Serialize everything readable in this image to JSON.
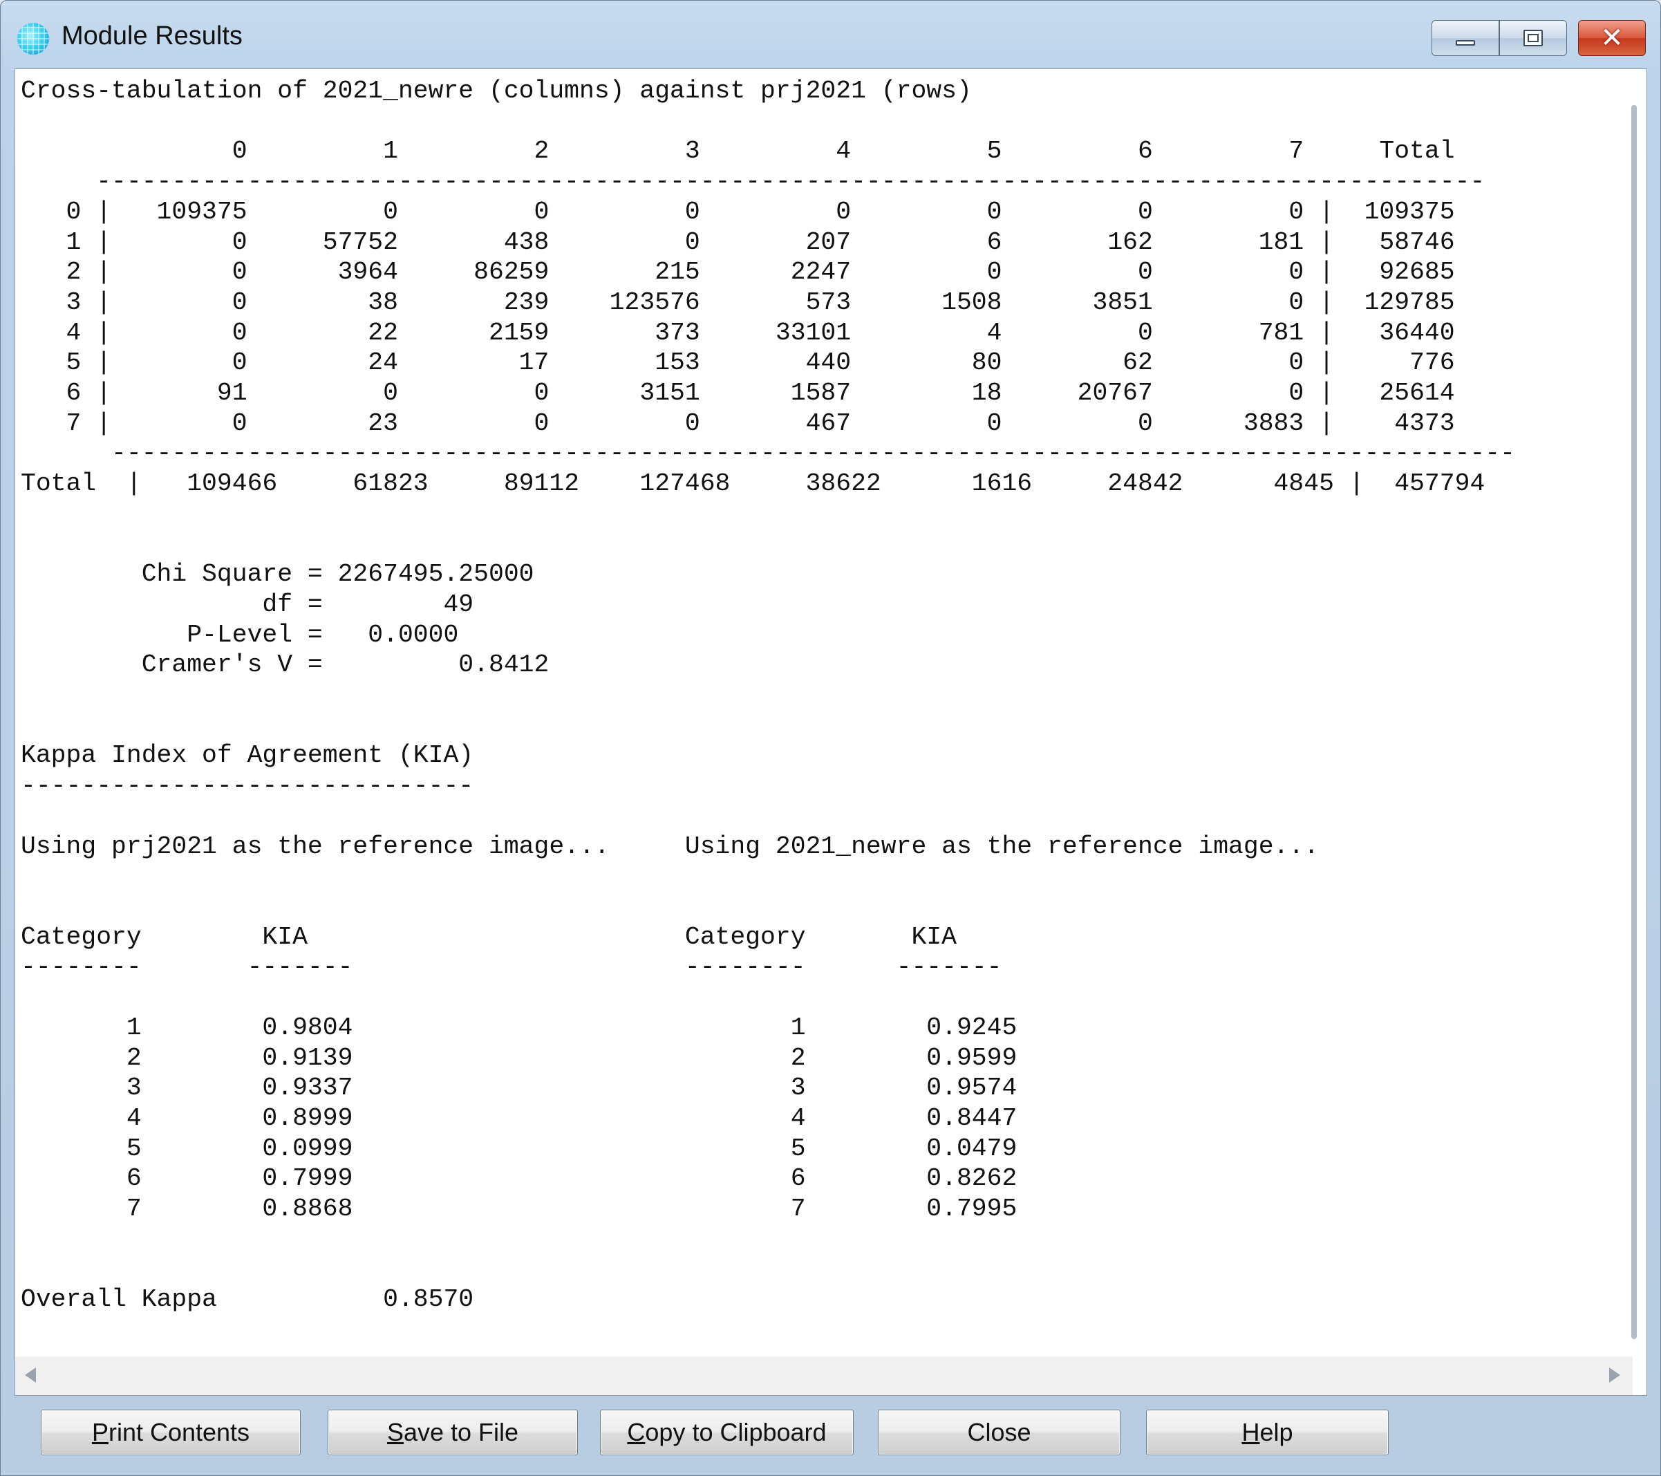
{
  "window": {
    "title": "Module Results",
    "icon": "idrisi-globe-icon",
    "controls": {
      "minimize": "minimize-icon",
      "maximize": "maximize-icon",
      "close": "close-icon"
    }
  },
  "report": {
    "text": "Cross-tabulation of 2021_newre (columns) against prj2021 (rows)\n\n              0         1         2         3         4         5         6         7     Total\n     --------------------------------------------------------------------------------------------\n   0 |   109375         0         0         0         0         0         0         0 |  109375\n   1 |        0     57752       438         0       207         6       162       181 |   58746\n   2 |        0      3964     86259       215      2247         0         0         0 |   92685\n   3 |        0        38       239    123576       573      1508      3851         0 |  129785\n   4 |        0        22      2159       373     33101         4         0       781 |   36440\n   5 |        0        24        17       153       440        80        62         0 |     776\n   6 |       91         0         0      3151      1587        18     20767         0 |   25614\n   7 |        0        23         0         0       467         0         0      3883 |    4373\n      ---------------------------------------------------------------------------------------------\nTotal  |   109466     61823     89112    127468     38622      1616     24842      4845 |  457794\n\n\n        Chi Square = 2267495.25000\n                df =        49\n           P-Level =   0.0000\n        Cramer's V =         0.8412\n\n\nKappa Index of Agreement (KIA)\n------------------------------\n\nUsing prj2021 as the reference image...     Using 2021_newre as the reference image...\n\n\nCategory        KIA                         Category       KIA\n--------       -------                      --------      -------\n\n       1        0.9804                             1        0.9245\n       2        0.9139                             2        0.9599\n       3        0.9337                             3        0.9574\n       4        0.8999                             4        0.8447\n       5        0.0999                             5        0.0479\n       6        0.7999                             6        0.8262\n       7        0.8868                             7        0.7995\n\n\nOverall Kappa           0.8570"
  },
  "buttons": {
    "print": {
      "pre": "",
      "acc": "P",
      "post": "rint Contents"
    },
    "save": {
      "pre": "",
      "acc": "S",
      "post": "ave to File"
    },
    "copy": {
      "pre": "",
      "acc": "C",
      "post": "opy to Clipboard"
    },
    "close": {
      "label": "Close"
    },
    "help": {
      "pre": "",
      "acc": "H",
      "post": "elp"
    }
  }
}
